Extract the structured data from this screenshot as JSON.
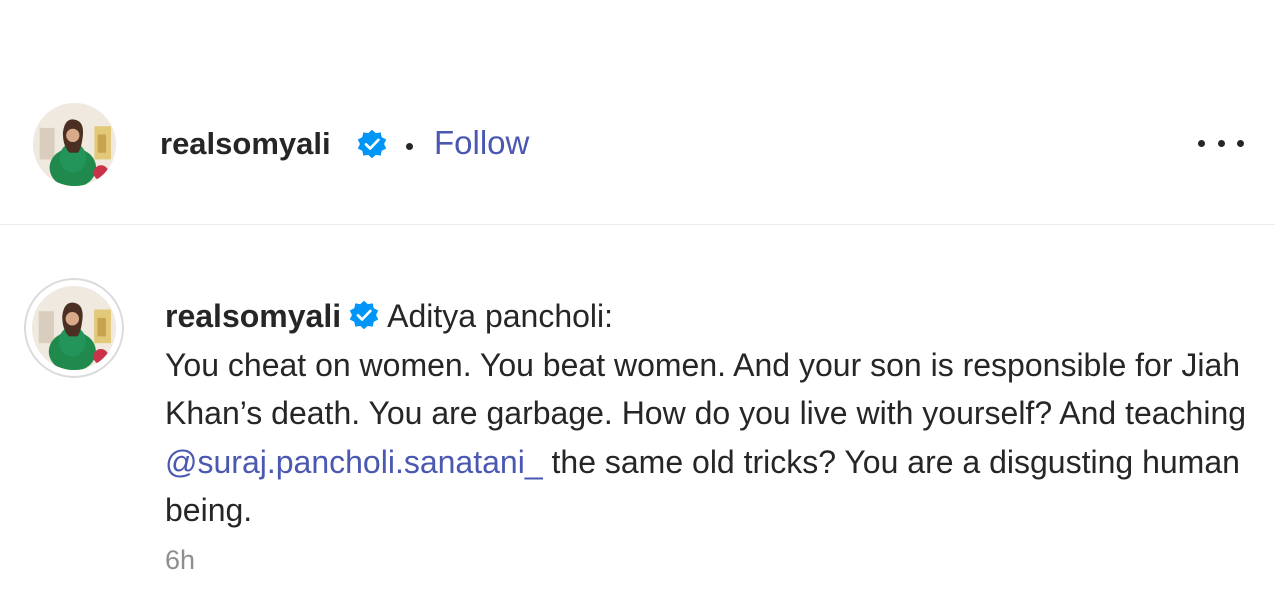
{
  "header": {
    "username": "realsomyali",
    "separator": "•",
    "follow_label": "Follow",
    "more_icon": "more-horizontal-icon"
  },
  "comment": {
    "username": "realsomyali",
    "first_line": "Aditya pancholi:",
    "body_before_mention": "You cheat on women. You beat women. And your son is responsible for Jiah Khan’s death. You are garbage. How do you live with yourself? And teaching",
    "mention": "@suraj.pancholi.sanatani_",
    "body_after_mention": "the same old tricks? You are a disgusting human being.",
    "timestamp": "6h"
  },
  "colors": {
    "link": "#4b58b2",
    "verified_badge": "#0095f6",
    "text": "#262626",
    "muted": "#8e8e8e"
  },
  "icons": [
    "verified-badge-icon",
    "more-horizontal-icon",
    "avatar-image"
  ]
}
